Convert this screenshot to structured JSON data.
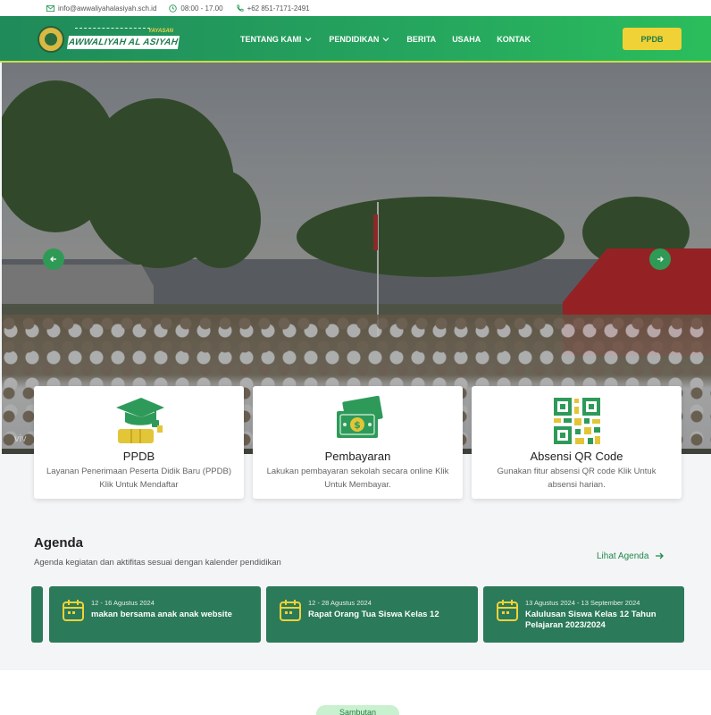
{
  "topbar": {
    "email": "info@awwaliyahalasiyah.sch.id",
    "hours": "08:00 - 17.00",
    "phone": "+62 851-7171-2491"
  },
  "logo": {
    "yayasan": "YAYASAN",
    "name": "AWWALIYAH AL ASIYAH"
  },
  "nav": {
    "items": [
      {
        "label": "TENTANG KAMI",
        "has_dropdown": true
      },
      {
        "label": "PENDIDIKAN",
        "has_dropdown": true
      },
      {
        "label": "BERITA",
        "has_dropdown": false
      },
      {
        "label": "USAHA",
        "has_dropdown": false
      },
      {
        "label": "KONTAK",
        "has_dropdown": false
      }
    ],
    "cta_label": "PPDB"
  },
  "hero": {
    "watermark": "viv"
  },
  "features": [
    {
      "title": "PPDB",
      "description": "Layanan Penerimaan Peserta Didik Baru (PPDB) Klik Untuk Mendaftar",
      "icon": "graduation-cap-icon"
    },
    {
      "title": "Pembayaran",
      "description": "Lakukan pembayaran sekolah secara online Klik Untuk Membayar.",
      "icon": "money-icon"
    },
    {
      "title": "Absensi QR Code",
      "description": "Gunakan fitur absensi QR code Klik Untuk absensi harian.",
      "icon": "qr-code-icon"
    }
  ],
  "agenda": {
    "title": "Agenda",
    "subtitle": "Agenda kegiatan dan aktifitas sesuai dengan kalender pendidikan",
    "link_label": "Lihat Agenda",
    "items": [
      {
        "date": "12 - 16 Agustus 2024",
        "title": "makan bersama anak anak website"
      },
      {
        "date": "12 - 28 Agustus 2024",
        "title": "Rapat Orang Tua Siswa Kelas 12"
      },
      {
        "date": "13 Agustus 2024 - 13 September 2024",
        "title": "Kalulusan Siswa Kelas 12 Tahun Pelajaran 2023/2024"
      }
    ]
  },
  "next_section": {
    "pill_label": "Sambutan"
  },
  "colors": {
    "primary_green": "#25a65e",
    "accent_yellow": "#f1d236",
    "agenda_card": "#2b7a5a"
  }
}
